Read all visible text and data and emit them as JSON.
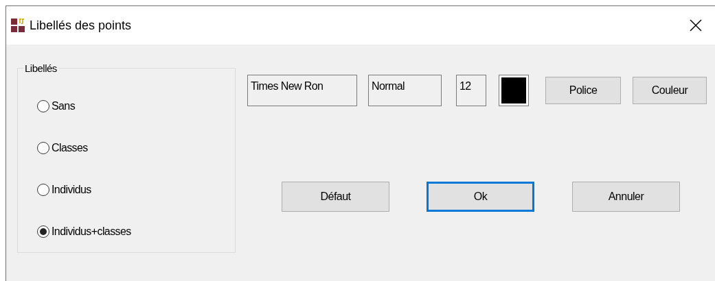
{
  "window": {
    "title": "Libellés des points"
  },
  "group": {
    "legend": "Libellés",
    "options": [
      {
        "label": "Sans",
        "selected": false
      },
      {
        "label": "Classes",
        "selected": false
      },
      {
        "label": "Individus",
        "selected": false
      },
      {
        "label": "Individus+classes",
        "selected": true
      }
    ]
  },
  "font": {
    "name": "Times New Ron",
    "style": "Normal",
    "size": "12",
    "color": "#000000"
  },
  "font_buttons": [
    "Police",
    "Couleur"
  ],
  "buttons": [
    {
      "label": "Défaut",
      "default": false
    },
    {
      "label": "Ok",
      "default": true
    },
    {
      "label": "Annuler",
      "default": false
    }
  ]
}
